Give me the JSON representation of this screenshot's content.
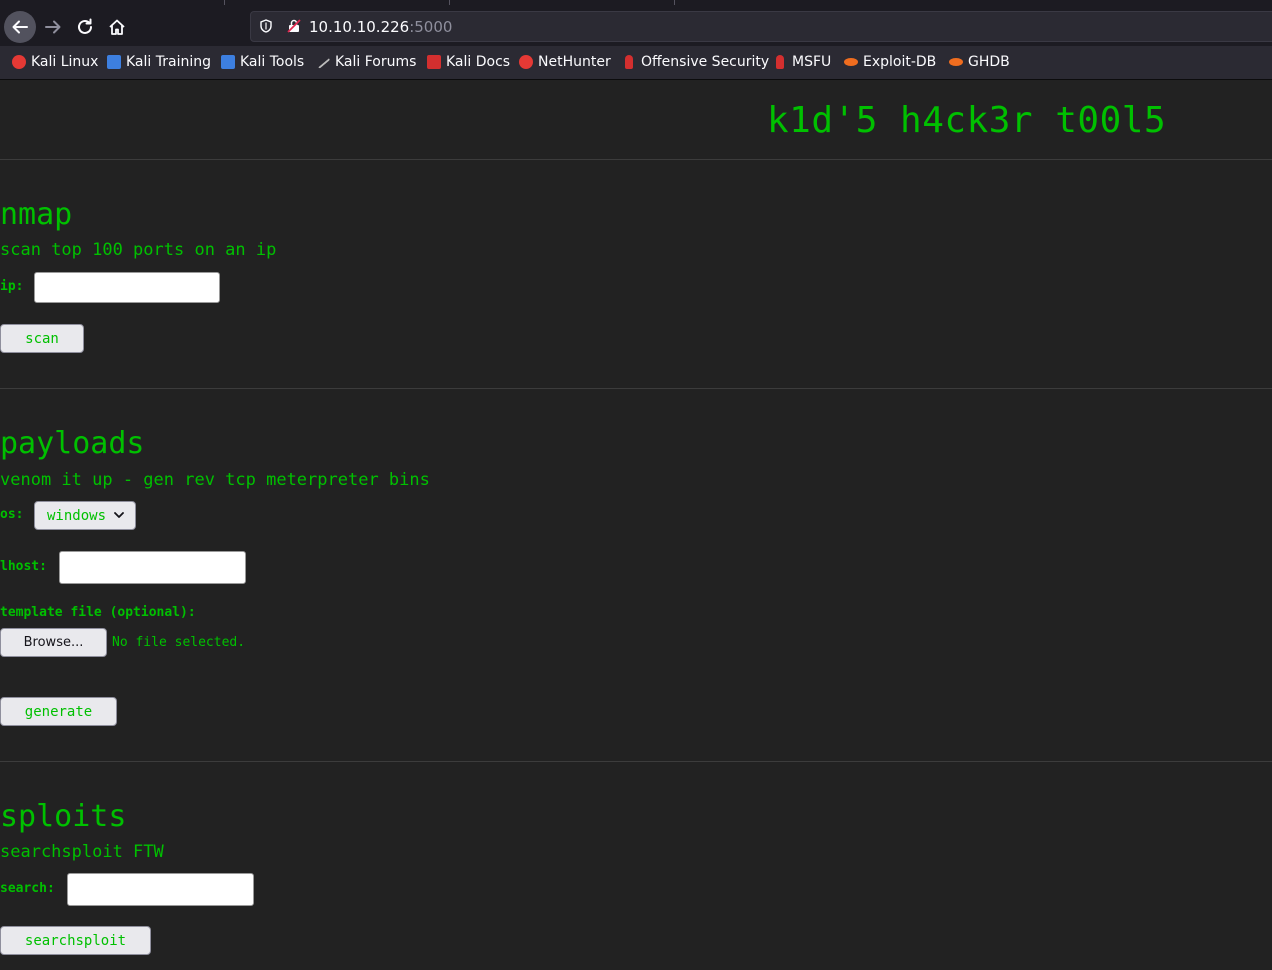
{
  "browser": {
    "url_host": "10.10.10.226",
    "url_port": ":5000",
    "bookmarks": [
      {
        "label": "Kali Linux",
        "icon": "kali-linux-icon",
        "color": "#e53935"
      },
      {
        "label": "Kali Training",
        "icon": "kali-training-icon",
        "color": "#3d7fe0"
      },
      {
        "label": "Kali Tools",
        "icon": "kali-tools-icon",
        "color": "#3d7fe0"
      },
      {
        "label": "Kali Forums",
        "icon": "kali-forums-icon",
        "color": "#222222"
      },
      {
        "label": "Kali Docs",
        "icon": "kali-docs-icon",
        "color": "#d32f2f"
      },
      {
        "label": "NetHunter",
        "icon": "nethunter-icon",
        "color": "#e53935"
      },
      {
        "label": "Offensive Security",
        "icon": "offsec-icon",
        "color": "#d32f2f"
      },
      {
        "label": "MSFU",
        "icon": "msfu-icon",
        "color": "#d32f2f"
      },
      {
        "label": "Exploit-DB",
        "icon": "exploit-db-icon",
        "color": "#f06d1f"
      },
      {
        "label": "GHDB",
        "icon": "ghdb-icon",
        "color": "#f06d1f"
      }
    ]
  },
  "page": {
    "title": "k1d'5 h4ck3r t00l5",
    "accent_color": "#00c000",
    "nmap": {
      "heading": "nmap",
      "description": "scan top 100 ports on an ip",
      "ip_label": "ip:",
      "ip_value": "",
      "submit_label": "scan"
    },
    "payloads": {
      "heading": "payloads",
      "description": "venom it up - gen rev tcp meterpreter bins",
      "os_label": "os:",
      "os_selected": "windows",
      "lhost_label": "lhost:",
      "lhost_value": "",
      "template_label": "template file (optional):",
      "browse_label": "Browse...",
      "no_file_text": "No file selected.",
      "submit_label": "generate"
    },
    "sploits": {
      "heading": "sploits",
      "description": "searchsploit FTW",
      "search_label": "search:",
      "search_value": "",
      "submit_label": "searchsploit"
    }
  }
}
